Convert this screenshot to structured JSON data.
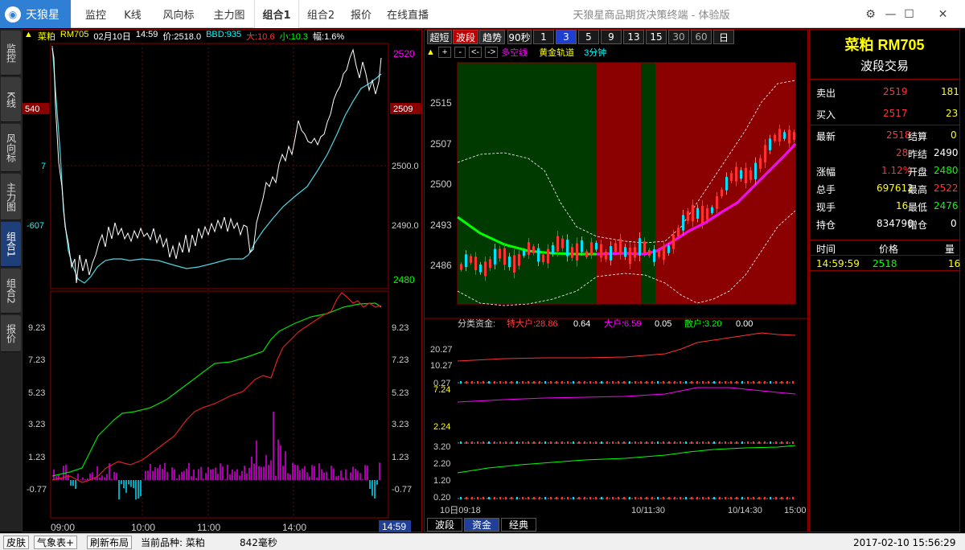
{
  "titlebar": {
    "logo": "天狼星",
    "tabs": [
      "监控",
      "K线",
      "风向标",
      "主力图",
      "组合1",
      "组合2",
      "报价",
      "在线直播"
    ],
    "active_tab": "组合1",
    "window_title": "天狼星商品期货决策终端 - 体验版",
    "icons": [
      "settings-icon",
      "minimize-icon",
      "maximize-icon",
      "close-icon"
    ]
  },
  "sidebar": {
    "tabs": [
      "监控",
      "K线",
      "风向标",
      "主力图",
      "组合1",
      "组合2",
      "报价"
    ],
    "active": "组合1"
  },
  "left_panel": {
    "header": {
      "name": "菜粕",
      "code": "RM705",
      "date": "02月10日",
      "time": "14:59",
      "price_label": "价:2518.0",
      "bbd_label": "BBD:935",
      "high_label": "大:10.6",
      "low_label": "小:10.3",
      "range_label": "幅:1.6%"
    },
    "left_axis": [
      "540",
      "7",
      "-607"
    ],
    "right_axis": [
      "2520",
      "2509",
      "2500.0",
      "2490.0",
      "2480"
    ],
    "lower_axis": [
      "9.23",
      "7.23",
      "5.23",
      "3.23",
      "1.23",
      "-0.77"
    ],
    "time_labels": [
      "09:00",
      "10:00",
      "11:00",
      "14:00",
      "14:59"
    ]
  },
  "mid_panel": {
    "mode_buttons": [
      "超短",
      "波段",
      "趋势"
    ],
    "active_mode": "波段",
    "period_buttons": [
      "90秒",
      "1",
      "3",
      "5",
      "9",
      "13",
      "15",
      "30",
      "60",
      "日"
    ],
    "active_period": "3",
    "toolbar": [
      "▲",
      "+",
      "-",
      "<-",
      "->"
    ],
    "legend": {
      "a": "多空线",
      "b": "黄金轨道",
      "c": "3分钟"
    },
    "price_axis": [
      "2515",
      "2507",
      "2500",
      "2493",
      "2486"
    ],
    "fund_header": {
      "label": "分类资金:",
      "big_label": "特大户:28.86",
      "big_val": "0.64",
      "large_label": "大户:6.59",
      "large_val": "0.05",
      "retail_label": "散户:3.20",
      "retail_val": "0.00"
    },
    "fund_axis_a": [
      "20.27",
      "10.27",
      "0.27"
    ],
    "fund_axis_b": [
      "7.24",
      "2.24"
    ],
    "fund_axis_c": [
      "3.20",
      "2.20",
      "1.20",
      "0.20"
    ],
    "time_labels": [
      "10日09:18",
      "10/11:30",
      "10/14:30",
      "15:00"
    ],
    "bottom_tabs": [
      "波段",
      "资金",
      "经典"
    ],
    "active_bottom_tab": "资金"
  },
  "right_panel": {
    "title": "菜粕 RM705",
    "subtitle": "波段交易",
    "sell": {
      "label": "卖出",
      "price": "2519",
      "volume": "181"
    },
    "buy": {
      "label": "买入",
      "price": "2517",
      "volume": "23"
    },
    "stats": [
      {
        "l1": "最新",
        "v1": "2518",
        "l2": "结算",
        "v2": "0"
      },
      {
        "l1": "",
        "v1": "28",
        "l2": "昨结",
        "v2": "2490"
      },
      {
        "l1": "涨幅",
        "v1": "1.12%",
        "l2": "开盘",
        "v2": "2480"
      },
      {
        "l1": "总手",
        "v1": "697612",
        "l2": "最高",
        "v2": "2522"
      },
      {
        "l1": "现手",
        "v1": "16",
        "l2": "最低",
        "v2": "2476"
      },
      {
        "l1": "持仓",
        "v1": "834790",
        "l2": "增仓",
        "v2": "0"
      }
    ],
    "trade_header": {
      "time": "时间",
      "price": "价格",
      "volume": "量"
    },
    "trade": {
      "time": "14:59:59",
      "price": "2518",
      "volume": "16"
    }
  },
  "bottombar": {
    "skin": "皮肤",
    "weather": "气象表+",
    "refresh": "刷新布局",
    "current": "当前品种: 菜粕",
    "latency": "842毫秒",
    "datetime": "2017-02-10 15:56:29"
  },
  "colors": {
    "bg": "#000000",
    "red": "#ff3232",
    "cyan": "#00ffff",
    "magenta": "#ff00ff",
    "green": "#00ff00",
    "yellow": "#ffff00",
    "white": "#ffffff",
    "border": "#8b0000",
    "bull_bg": "#8b0000",
    "bear_bg": "#003a00",
    "accent": "#2f7fd4"
  }
}
